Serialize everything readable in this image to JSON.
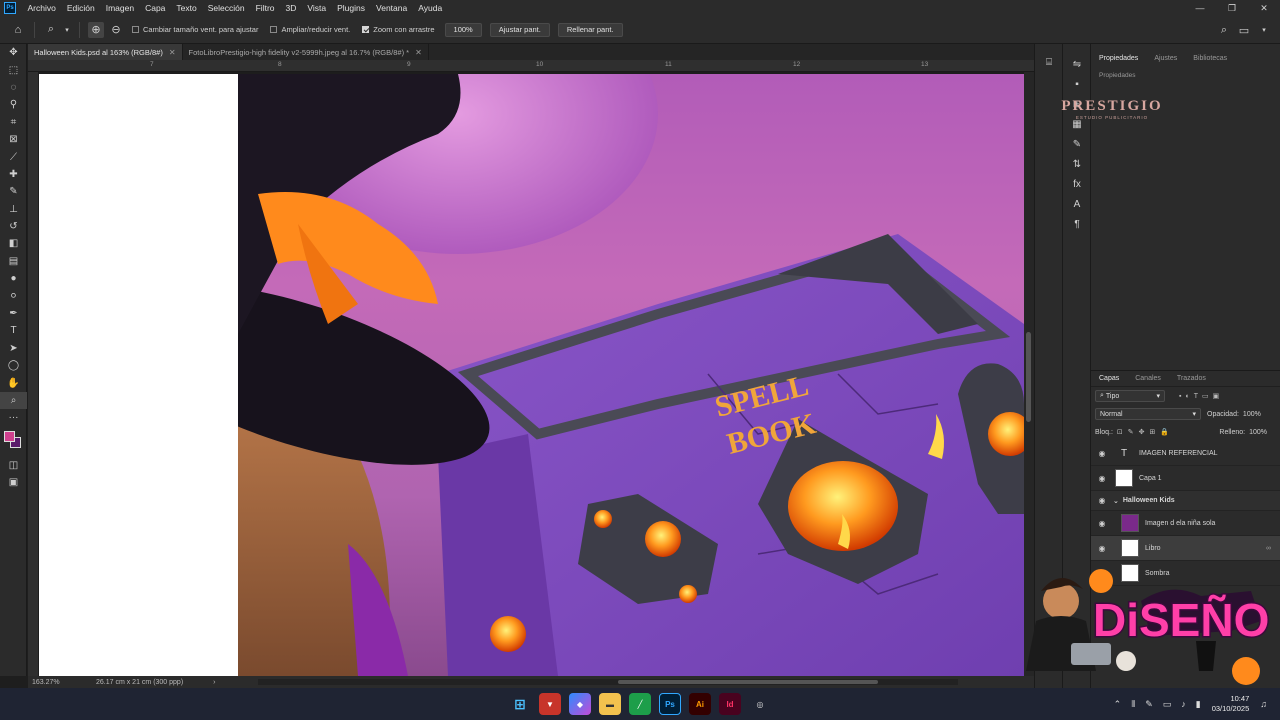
{
  "menubar": {
    "app_logo": "Ps",
    "items": [
      "Archivo",
      "Edición",
      "Imagen",
      "Capa",
      "Texto",
      "Selección",
      "Filtro",
      "3D",
      "Vista",
      "Plugins",
      "Ventana",
      "Ayuda"
    ]
  },
  "options": {
    "resize_windows": "Cambiar tamaño vent. para ajustar",
    "zoom_all_windows": "Ampliar/reducir vent.",
    "scrubby_zoom": "Zoom con arrastre",
    "zoom_value": "100%",
    "fit_screen": "Ajustar pant.",
    "fill_screen": "Rellenar pant."
  },
  "tabs": [
    {
      "label": "Halloween Kids.psd al 163% (RGB/8#)",
      "active": true
    },
    {
      "label": "FotoLibroPrestigio-high fidelity v2-5999h.jpeg al 16.7% (RGB/8#) *",
      "active": false
    }
  ],
  "ruler": {
    "numbers": [
      "7",
      "8",
      "9",
      "10",
      "11",
      "12",
      "13"
    ]
  },
  "status": {
    "zoom": "163.27%",
    "doc_size": "26.17 cm x 21 cm (300 ppp)"
  },
  "canvas": {
    "book_title_line1": "SPELL",
    "book_title_line2": "BOOK"
  },
  "watermark": {
    "brand": "PRESTIGIO",
    "sub": "ESTUDIO PUBLICITARIO",
    "promo": "DiSEÑO"
  },
  "panels": {
    "top_tabs": [
      "Propiedades",
      "Ajustes",
      "Bibliotecas"
    ],
    "props_sub": "Propiedades",
    "layer_tabs": [
      "Capas",
      "Canales",
      "Trazados"
    ],
    "filter_kind": "Tipo",
    "blend_mode": "Normal",
    "opacity_label": "Opacidad:",
    "opacity_value": "100%",
    "lock_label": "Bloq.:",
    "fill_label": "Relleno:",
    "fill_value": "100%",
    "layers": [
      {
        "name": "IMAGEN REFERENCIAL",
        "kind": "text"
      },
      {
        "name": "Capa 1",
        "kind": "image"
      },
      {
        "name": "Halloween Kids",
        "kind": "group"
      },
      {
        "name": "Imagen d ela niña sola",
        "kind": "image"
      },
      {
        "name": "Libro",
        "kind": "image"
      },
      {
        "name": "Sombra",
        "kind": "image"
      }
    ]
  },
  "taskbar": {
    "time": "10:47",
    "date": "03/10/2025"
  }
}
